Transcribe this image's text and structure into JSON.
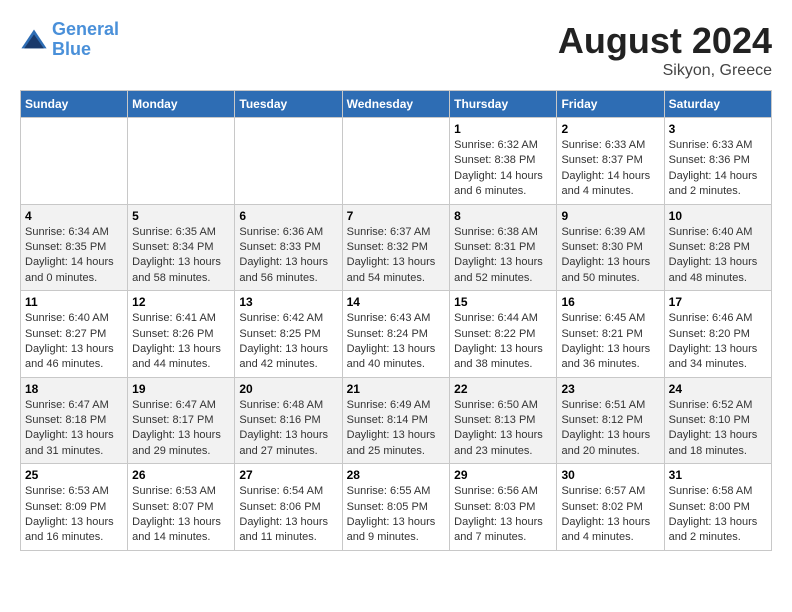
{
  "header": {
    "logo_line1": "General",
    "logo_line2": "Blue",
    "month": "August 2024",
    "location": "Sikyon, Greece"
  },
  "days_of_week": [
    "Sunday",
    "Monday",
    "Tuesday",
    "Wednesday",
    "Thursday",
    "Friday",
    "Saturday"
  ],
  "weeks": [
    [
      {
        "num": "",
        "detail": ""
      },
      {
        "num": "",
        "detail": ""
      },
      {
        "num": "",
        "detail": ""
      },
      {
        "num": "",
        "detail": ""
      },
      {
        "num": "1",
        "detail": "Sunrise: 6:32 AM\nSunset: 8:38 PM\nDaylight: 14 hours\nand 6 minutes."
      },
      {
        "num": "2",
        "detail": "Sunrise: 6:33 AM\nSunset: 8:37 PM\nDaylight: 14 hours\nand 4 minutes."
      },
      {
        "num": "3",
        "detail": "Sunrise: 6:33 AM\nSunset: 8:36 PM\nDaylight: 14 hours\nand 2 minutes."
      }
    ],
    [
      {
        "num": "4",
        "detail": "Sunrise: 6:34 AM\nSunset: 8:35 PM\nDaylight: 14 hours\nand 0 minutes."
      },
      {
        "num": "5",
        "detail": "Sunrise: 6:35 AM\nSunset: 8:34 PM\nDaylight: 13 hours\nand 58 minutes."
      },
      {
        "num": "6",
        "detail": "Sunrise: 6:36 AM\nSunset: 8:33 PM\nDaylight: 13 hours\nand 56 minutes."
      },
      {
        "num": "7",
        "detail": "Sunrise: 6:37 AM\nSunset: 8:32 PM\nDaylight: 13 hours\nand 54 minutes."
      },
      {
        "num": "8",
        "detail": "Sunrise: 6:38 AM\nSunset: 8:31 PM\nDaylight: 13 hours\nand 52 minutes."
      },
      {
        "num": "9",
        "detail": "Sunrise: 6:39 AM\nSunset: 8:30 PM\nDaylight: 13 hours\nand 50 minutes."
      },
      {
        "num": "10",
        "detail": "Sunrise: 6:40 AM\nSunset: 8:28 PM\nDaylight: 13 hours\nand 48 minutes."
      }
    ],
    [
      {
        "num": "11",
        "detail": "Sunrise: 6:40 AM\nSunset: 8:27 PM\nDaylight: 13 hours\nand 46 minutes."
      },
      {
        "num": "12",
        "detail": "Sunrise: 6:41 AM\nSunset: 8:26 PM\nDaylight: 13 hours\nand 44 minutes."
      },
      {
        "num": "13",
        "detail": "Sunrise: 6:42 AM\nSunset: 8:25 PM\nDaylight: 13 hours\nand 42 minutes."
      },
      {
        "num": "14",
        "detail": "Sunrise: 6:43 AM\nSunset: 8:24 PM\nDaylight: 13 hours\nand 40 minutes."
      },
      {
        "num": "15",
        "detail": "Sunrise: 6:44 AM\nSunset: 8:22 PM\nDaylight: 13 hours\nand 38 minutes."
      },
      {
        "num": "16",
        "detail": "Sunrise: 6:45 AM\nSunset: 8:21 PM\nDaylight: 13 hours\nand 36 minutes."
      },
      {
        "num": "17",
        "detail": "Sunrise: 6:46 AM\nSunset: 8:20 PM\nDaylight: 13 hours\nand 34 minutes."
      }
    ],
    [
      {
        "num": "18",
        "detail": "Sunrise: 6:47 AM\nSunset: 8:18 PM\nDaylight: 13 hours\nand 31 minutes."
      },
      {
        "num": "19",
        "detail": "Sunrise: 6:47 AM\nSunset: 8:17 PM\nDaylight: 13 hours\nand 29 minutes."
      },
      {
        "num": "20",
        "detail": "Sunrise: 6:48 AM\nSunset: 8:16 PM\nDaylight: 13 hours\nand 27 minutes."
      },
      {
        "num": "21",
        "detail": "Sunrise: 6:49 AM\nSunset: 8:14 PM\nDaylight: 13 hours\nand 25 minutes."
      },
      {
        "num": "22",
        "detail": "Sunrise: 6:50 AM\nSunset: 8:13 PM\nDaylight: 13 hours\nand 23 minutes."
      },
      {
        "num": "23",
        "detail": "Sunrise: 6:51 AM\nSunset: 8:12 PM\nDaylight: 13 hours\nand 20 minutes."
      },
      {
        "num": "24",
        "detail": "Sunrise: 6:52 AM\nSunset: 8:10 PM\nDaylight: 13 hours\nand 18 minutes."
      }
    ],
    [
      {
        "num": "25",
        "detail": "Sunrise: 6:53 AM\nSunset: 8:09 PM\nDaylight: 13 hours\nand 16 minutes."
      },
      {
        "num": "26",
        "detail": "Sunrise: 6:53 AM\nSunset: 8:07 PM\nDaylight: 13 hours\nand 14 minutes."
      },
      {
        "num": "27",
        "detail": "Sunrise: 6:54 AM\nSunset: 8:06 PM\nDaylight: 13 hours\nand 11 minutes."
      },
      {
        "num": "28",
        "detail": "Sunrise: 6:55 AM\nSunset: 8:05 PM\nDaylight: 13 hours\nand 9 minutes."
      },
      {
        "num": "29",
        "detail": "Sunrise: 6:56 AM\nSunset: 8:03 PM\nDaylight: 13 hours\nand 7 minutes."
      },
      {
        "num": "30",
        "detail": "Sunrise: 6:57 AM\nSunset: 8:02 PM\nDaylight: 13 hours\nand 4 minutes."
      },
      {
        "num": "31",
        "detail": "Sunrise: 6:58 AM\nSunset: 8:00 PM\nDaylight: 13 hours\nand 2 minutes."
      }
    ]
  ]
}
